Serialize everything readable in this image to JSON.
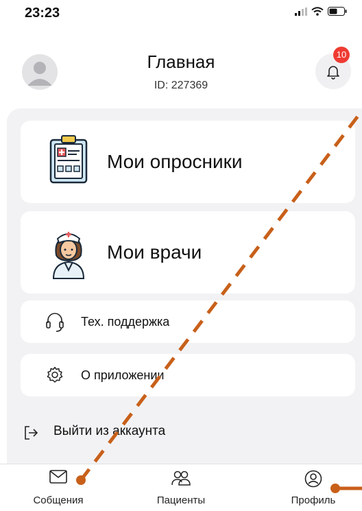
{
  "status_bar": {
    "time": "23:23"
  },
  "header": {
    "title": "Главная",
    "user_id": "ID: 227369",
    "notification_count": "10"
  },
  "menu": {
    "surveys": "Мои опросники",
    "doctors": "Мои врачи",
    "support": "Тех. поддержка",
    "about": "О приложении",
    "logout": "Выйти из аккаунта"
  },
  "tabbar": {
    "messages": "Собщения",
    "patients": "Пациенты",
    "profile": "Профиль"
  },
  "colors": {
    "annotation": "#c8601a",
    "badge": "#ef3b33",
    "background": "#f2f2f4"
  },
  "icons": [
    "avatar-icon",
    "bell-icon",
    "clipboard-icon",
    "nurse-icon",
    "headset-icon",
    "gear-icon",
    "logout-icon",
    "mail-icon",
    "people-icon",
    "user-circle-icon"
  ]
}
